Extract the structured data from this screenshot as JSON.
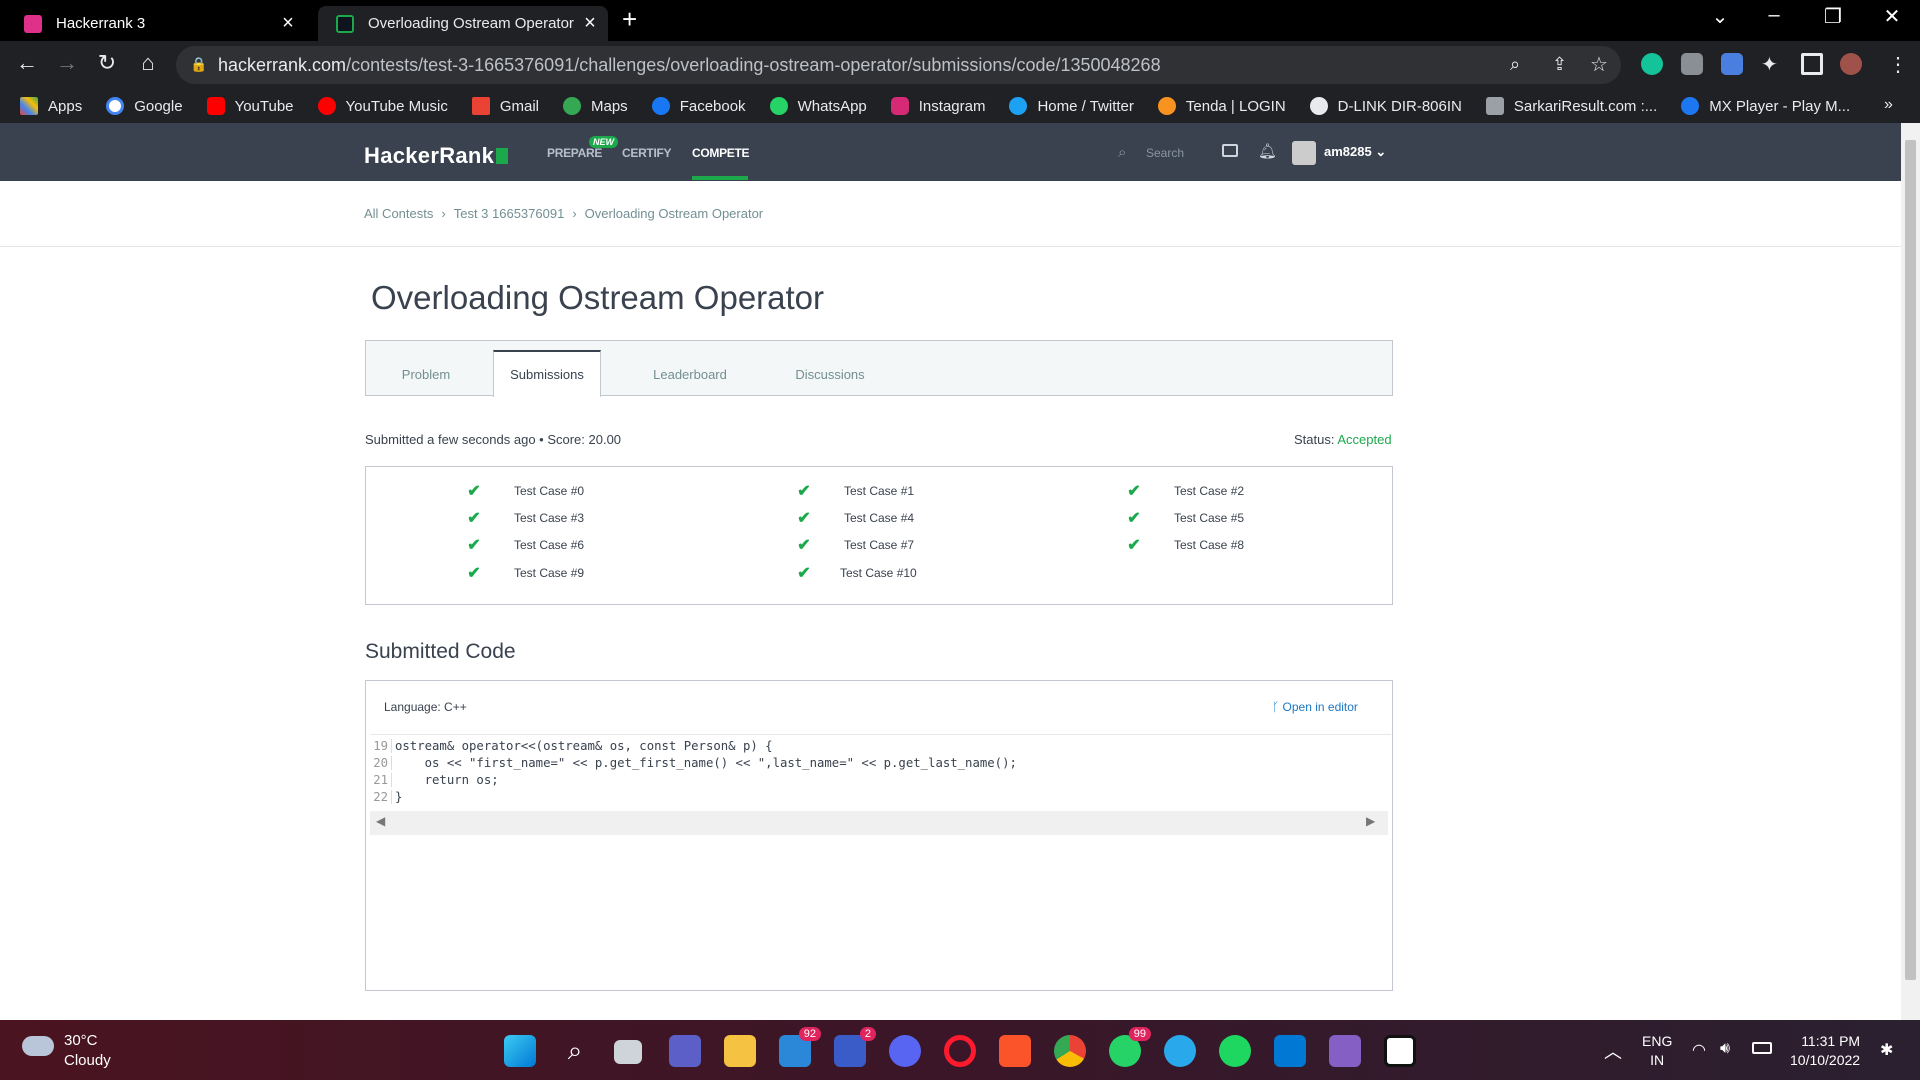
{
  "browser": {
    "tabs": [
      {
        "title": "Hackerrank 3"
      },
      {
        "title": "Overloading Ostream Operator S"
      }
    ],
    "url_host": "hackerrank.com",
    "url_path": "/contests/test-3-1665376091/challenges/overloading-ostream-operator/submissions/code/1350048268",
    "bookmarks": [
      "Apps",
      "Google",
      "YouTube",
      "YouTube Music",
      "Gmail",
      "Maps",
      "Facebook",
      "WhatsApp",
      "Instagram",
      "Home / Twitter",
      "Tenda | LOGIN",
      "D-LINK DIR-806IN",
      "SarkariResult.com :...",
      "MX Player - Play M..."
    ],
    "more": "»"
  },
  "header": {
    "logo": "HackerRank",
    "nav": [
      "PREPARE",
      "CERTIFY",
      "COMPETE"
    ],
    "new_badge": "NEW",
    "search_placeholder": "Search",
    "user": "am8285"
  },
  "breadcrumb": [
    "All Contests",
    "Test 3 1665376091",
    "Overloading Ostream Operator"
  ],
  "page_title": "Overloading Ostream Operator",
  "tabs": [
    "Problem",
    "Submissions",
    "Leaderboard",
    "Discussions"
  ],
  "submission": {
    "meta": "Submitted a few seconds ago • Score: 20.00",
    "status_label": "Status:",
    "status_value": "Accepted"
  },
  "test_cases": [
    "Test Case #0",
    "Test Case #1",
    "Test Case #2",
    "Test Case #3",
    "Test Case #4",
    "Test Case #5",
    "Test Case #6",
    "Test Case #7",
    "Test Case #8",
    "Test Case #9",
    "Test Case #10"
  ],
  "code": {
    "heading": "Submitted Code",
    "language": "Language: C++",
    "open_editor": "Open in editor",
    "lines": [
      {
        "n": "19",
        "text": "ostream& operator<<(ostream& os, const Person& p) {"
      },
      {
        "n": "20",
        "text": "    os << \"first_name=\" << p.get_first_name() << \",last_name=\" << p.get_last_name();"
      },
      {
        "n": "21",
        "text": "    return os;"
      },
      {
        "n": "22",
        "text": "}"
      }
    ]
  },
  "taskbar": {
    "temp": "30°C",
    "weather": "Cloudy",
    "badges": [
      "92",
      "2",
      "99"
    ],
    "lang1": "ENG",
    "lang2": "IN",
    "time": "11:31 PM",
    "date": "10/10/2022"
  },
  "colors": {
    "accent": "#1ba94c",
    "header_bg": "#39424e",
    "link": "#1c77c3"
  }
}
